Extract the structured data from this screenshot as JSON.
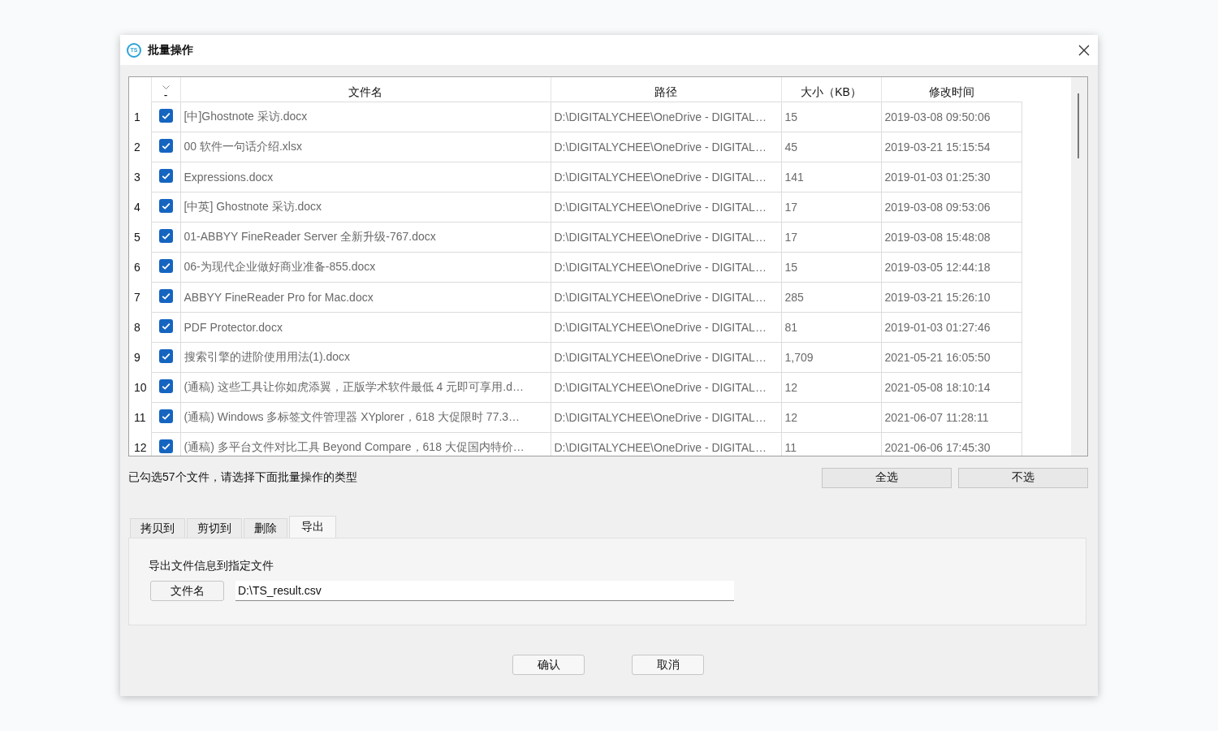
{
  "window": {
    "logo_text": "TS",
    "title": "批量操作"
  },
  "table": {
    "check_header": "-",
    "columns": [
      "文件名",
      "路径",
      "大小（KB）",
      "修改时间"
    ],
    "rows": [
      {
        "index": "1",
        "checked": true,
        "name": "[中]Ghostnote 采访.docx",
        "path": "D:\\DIGITALYCHEE\\OneDrive - DIGITAL…",
        "size": "15",
        "modified": "2019-03-08 09:50:06"
      },
      {
        "index": "2",
        "checked": true,
        "name": "00 软件一句话介绍.xlsx",
        "path": "D:\\DIGITALYCHEE\\OneDrive - DIGITAL…",
        "size": "45",
        "modified": "2019-03-21 15:15:54"
      },
      {
        "index": "3",
        "checked": true,
        "name": "Expressions.docx",
        "path": "D:\\DIGITALYCHEE\\OneDrive - DIGITAL…",
        "size": "141",
        "modified": "2019-01-03 01:25:30"
      },
      {
        "index": "4",
        "checked": true,
        "name": "[中英] Ghostnote 采访.docx",
        "path": "D:\\DIGITALYCHEE\\OneDrive - DIGITAL…",
        "size": "17",
        "modified": "2019-03-08 09:53:06"
      },
      {
        "index": "5",
        "checked": true,
        "name": "01-ABBYY FineReader Server 全新升级-767.docx",
        "path": "D:\\DIGITALYCHEE\\OneDrive - DIGITAL…",
        "size": "17",
        "modified": "2019-03-08 15:48:08"
      },
      {
        "index": "6",
        "checked": true,
        "name": "06-为现代企业做好商业准备-855.docx",
        "path": "D:\\DIGITALYCHEE\\OneDrive - DIGITAL…",
        "size": "15",
        "modified": "2019-03-05 12:44:18"
      },
      {
        "index": "7",
        "checked": true,
        "name": "ABBYY FineReader Pro for Mac.docx",
        "path": "D:\\DIGITALYCHEE\\OneDrive - DIGITAL…",
        "size": "285",
        "modified": "2019-03-21 15:26:10"
      },
      {
        "index": "8",
        "checked": true,
        "name": "PDF Protector.docx",
        "path": "D:\\DIGITALYCHEE\\OneDrive - DIGITAL…",
        "size": "81",
        "modified": "2019-01-03 01:27:46"
      },
      {
        "index": "9",
        "checked": true,
        "name": "搜索引擎的进阶使用用法(1).docx",
        "path": "D:\\DIGITALYCHEE\\OneDrive - DIGITAL…",
        "size": "1,709",
        "modified": "2021-05-21 16:05:50"
      },
      {
        "index": "10",
        "checked": true,
        "name": "(通稿) 这些工具让你如虎添翼，正版学术软件最低 4 元即可享用.d…",
        "path": "D:\\DIGITALYCHEE\\OneDrive - DIGITAL…",
        "size": "12",
        "modified": "2021-05-08 18:10:14"
      },
      {
        "index": "11",
        "checked": true,
        "name": "(通稿) Windows 多标签文件管理器 XYplorer，618 大促限时 77.3…",
        "path": "D:\\DIGITALYCHEE\\OneDrive - DIGITAL…",
        "size": "12",
        "modified": "2021-06-07 11:28:11"
      },
      {
        "index": "12",
        "checked": true,
        "name": "(通稿) 多平台文件对比工具 Beyond Compare，618 大促国内特价…",
        "path": "D:\\DIGITALYCHEE\\OneDrive - DIGITAL…",
        "size": "11",
        "modified": "2021-06-06 17:45:30"
      }
    ]
  },
  "selection_summary": "已勾选57个文件，请选择下面批量操作的类型",
  "select_buttons": [
    "全选",
    "不选"
  ],
  "tabs": [
    {
      "label": "拷贝到",
      "selected": false
    },
    {
      "label": "剪切到",
      "selected": false
    },
    {
      "label": "删除",
      "selected": false
    },
    {
      "label": "导出",
      "selected": true
    }
  ],
  "export_panel": {
    "description": "导出文件信息到指定文件",
    "file_button": "文件名",
    "file_value": "D:\\TS_result.csv"
  },
  "buttons": [
    "确认",
    "取消"
  ]
}
